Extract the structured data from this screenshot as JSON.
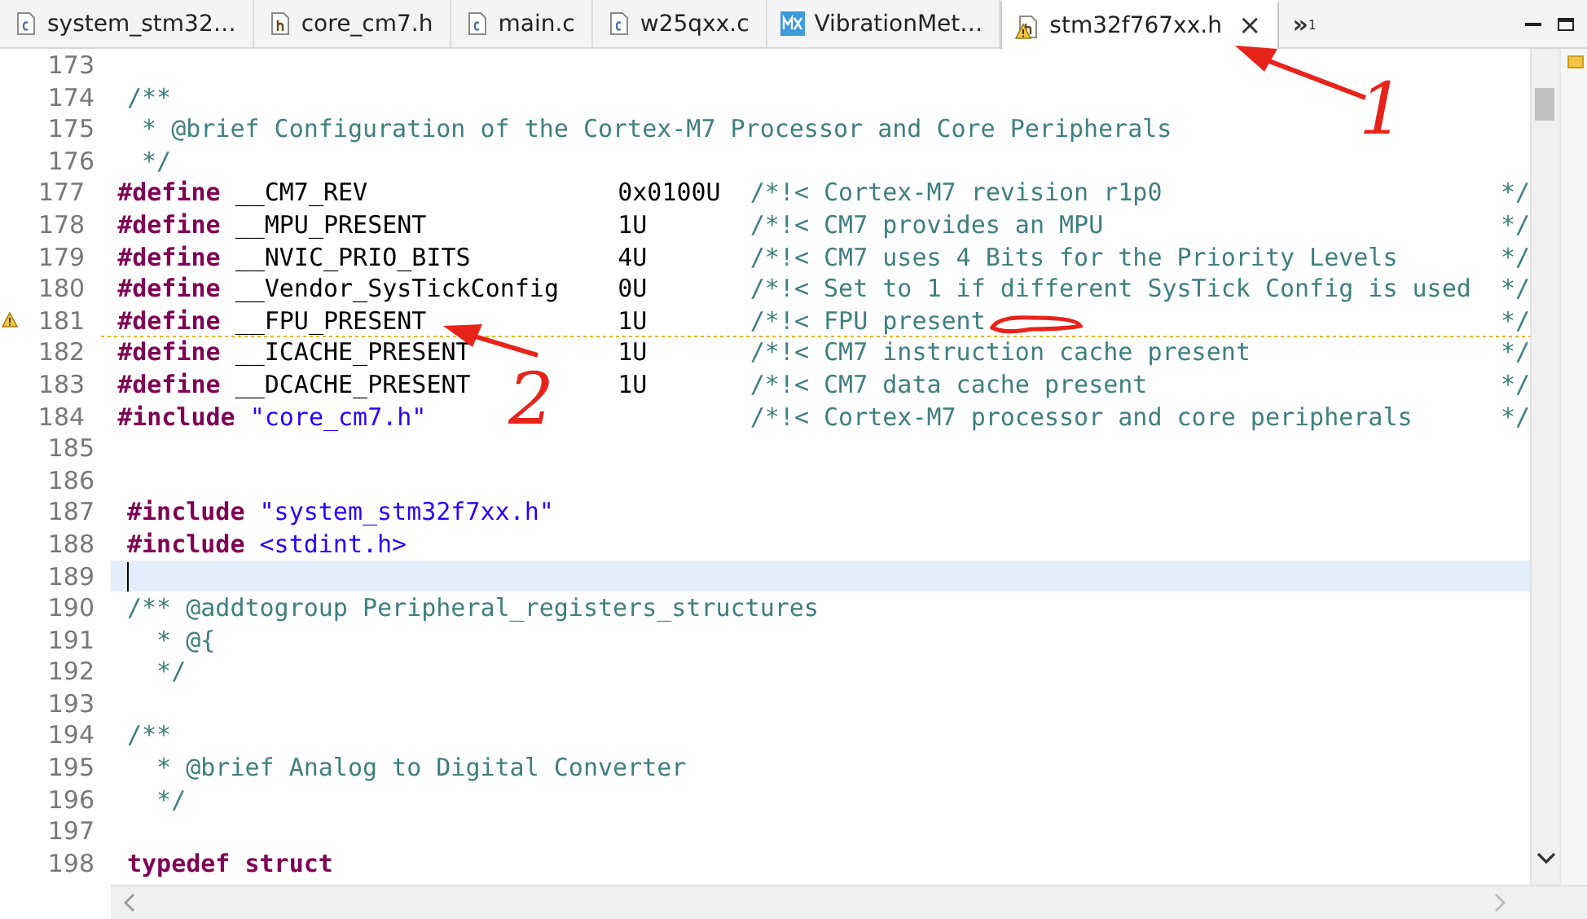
{
  "tabs": [
    {
      "label": "system_stm32…",
      "kind": "c",
      "warning": false,
      "selected": false,
      "closable": false
    },
    {
      "label": "core_cm7.h",
      "kind": "h",
      "warning": false,
      "selected": false,
      "closable": false
    },
    {
      "label": "main.c",
      "kind": "c",
      "warning": false,
      "selected": false,
      "closable": false
    },
    {
      "label": "w25qxx.c",
      "kind": "c",
      "warning": false,
      "selected": false,
      "closable": false
    },
    {
      "label": "VibrationMet…",
      "kind": "mx",
      "warning": false,
      "selected": false,
      "closable": false
    },
    {
      "label": "stm32f767xx.h",
      "kind": "h",
      "warning": true,
      "selected": true,
      "closable": true
    }
  ],
  "tab_overflow": {
    "symbol": "»",
    "count": "1"
  },
  "close_symbol": "×",
  "editor": {
    "lines": [
      {
        "number": "173",
        "kind": "text",
        "warning": false,
        "current": false
      },
      {
        "number": "174",
        "kind": "text",
        "warning": false,
        "current": false,
        "segments": [
          {
            "kind": "comment",
            "text": "/**"
          }
        ]
      },
      {
        "number": "175",
        "kind": "text",
        "warning": false,
        "current": false,
        "segments": [
          {
            "kind": "comment",
            "text": " * @brief Configuration of the Cortex-M7 Processor and Core Peripherals"
          }
        ]
      },
      {
        "number": "176",
        "kind": "text",
        "warning": false,
        "current": false,
        "segments": [
          {
            "kind": "comment",
            "text": " */"
          }
        ]
      },
      {
        "number": "177",
        "kind": "define",
        "warning": false,
        "current": false,
        "directive": "#define",
        "name": "__CM7_REV",
        "value": "0x0100U",
        "comment": "/*!< Cortex-M7 revision r1p0",
        "comment_end": "*/"
      },
      {
        "number": "178",
        "kind": "define",
        "warning": false,
        "current": false,
        "directive": "#define",
        "name": "__MPU_PRESENT",
        "value": "1U",
        "comment": "/*!< CM7 provides an MPU",
        "comment_end": "*/"
      },
      {
        "number": "179",
        "kind": "define",
        "warning": false,
        "current": false,
        "directive": "#define",
        "name": "__NVIC_PRIO_BITS",
        "value": "4U",
        "comment": "/*!< CM7 uses 4 Bits for the Priority Levels",
        "comment_end": "*/"
      },
      {
        "number": "180",
        "kind": "define",
        "warning": false,
        "current": false,
        "directive": "#define",
        "name": "__Vendor_SysTickConfig",
        "value": "0U",
        "comment": "/*!< Set to 1 if different SysTick Config is used",
        "comment_end": "*/"
      },
      {
        "number": "181",
        "kind": "define",
        "warning": true,
        "current": false,
        "directive": "#define",
        "name": "__FPU_PRESENT",
        "value": "1U",
        "comment": "/*!< FPU present",
        "comment_end": "*/"
      },
      {
        "number": "182",
        "kind": "define",
        "warning": false,
        "current": false,
        "directive": "#define",
        "name": "__ICACHE_PRESENT",
        "value": "1U",
        "comment": "/*!< CM7 instruction cache present",
        "comment_end": "*/"
      },
      {
        "number": "183",
        "kind": "define",
        "warning": false,
        "current": false,
        "directive": "#define",
        "name": "__DCACHE_PRESENT",
        "value": "1U",
        "comment": "/*!< CM7 data cache present",
        "comment_end": "*/"
      },
      {
        "number": "184",
        "kind": "include",
        "warning": false,
        "current": false,
        "directive": "#include",
        "path": "\"core_cm7.h\"",
        "comment": "/*!< Cortex-M7 processor and core peripherals",
        "comment_end": "*/"
      },
      {
        "number": "185",
        "kind": "text",
        "warning": false,
        "current": false
      },
      {
        "number": "186",
        "kind": "text",
        "warning": false,
        "current": false
      },
      {
        "number": "187",
        "kind": "include",
        "warning": false,
        "current": false,
        "directive": "#include",
        "path": "\"system_stm32f7xx.h\""
      },
      {
        "number": "188",
        "kind": "include",
        "warning": false,
        "current": false,
        "directive": "#include",
        "path": "<stdint.h>"
      },
      {
        "number": "189",
        "kind": "text",
        "warning": false,
        "current": true
      },
      {
        "number": "190",
        "kind": "text",
        "warning": false,
        "current": false,
        "segments": [
          {
            "kind": "comment",
            "text": "/** @addtogroup Peripheral_registers_structures"
          }
        ]
      },
      {
        "number": "191",
        "kind": "text",
        "warning": false,
        "current": false,
        "segments": [
          {
            "kind": "comment",
            "text": "  * @{"
          }
        ]
      },
      {
        "number": "192",
        "kind": "text",
        "warning": false,
        "current": false,
        "segments": [
          {
            "kind": "comment",
            "text": "  */"
          }
        ]
      },
      {
        "number": "193",
        "kind": "text",
        "warning": false,
        "current": false
      },
      {
        "number": "194",
        "kind": "text",
        "warning": false,
        "current": false,
        "segments": [
          {
            "kind": "comment",
            "text": "/**"
          }
        ]
      },
      {
        "number": "195",
        "kind": "text",
        "warning": false,
        "current": false,
        "segments": [
          {
            "kind": "comment",
            "text": "  * @brief Analog to Digital Converter"
          }
        ]
      },
      {
        "number": "196",
        "kind": "text",
        "warning": false,
        "current": false,
        "segments": [
          {
            "kind": "comment",
            "text": "  */"
          }
        ]
      },
      {
        "number": "197",
        "kind": "text",
        "warning": false,
        "current": false
      },
      {
        "number": "198",
        "kind": "text",
        "warning": false,
        "current": false,
        "segments": [
          {
            "kind": "keyword",
            "text": "typedef struct"
          }
        ]
      }
    ]
  },
  "annotations": [
    {
      "kind": "arrow",
      "label": "1"
    },
    {
      "kind": "arrow",
      "label": "2"
    },
    {
      "kind": "circle"
    }
  ]
}
